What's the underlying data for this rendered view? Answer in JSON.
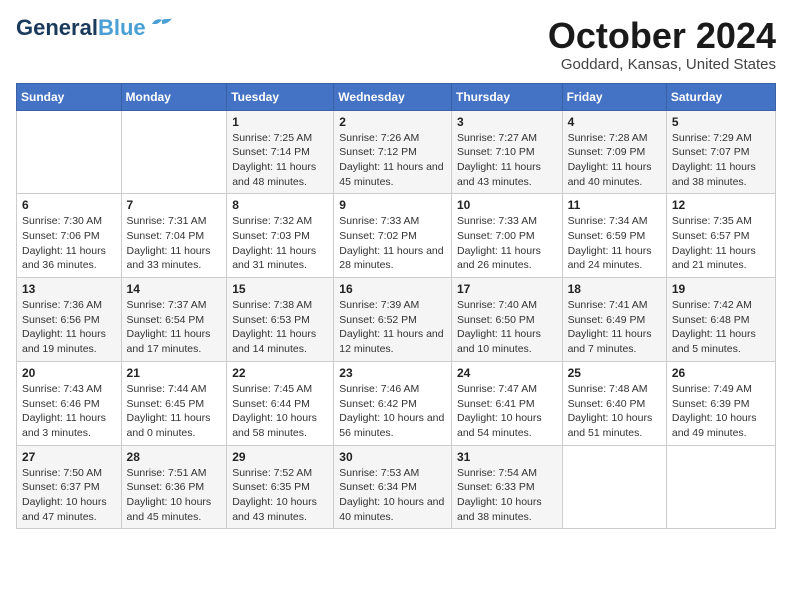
{
  "header": {
    "logo_line1": "General",
    "logo_line2": "Blue",
    "month_title": "October 2024",
    "location": "Goddard, Kansas, United States"
  },
  "weekdays": [
    "Sunday",
    "Monday",
    "Tuesday",
    "Wednesday",
    "Thursday",
    "Friday",
    "Saturday"
  ],
  "weeks": [
    [
      {
        "day": "",
        "info": ""
      },
      {
        "day": "",
        "info": ""
      },
      {
        "day": "1",
        "info": "Sunrise: 7:25 AM\nSunset: 7:14 PM\nDaylight: 11 hours and 48 minutes."
      },
      {
        "day": "2",
        "info": "Sunrise: 7:26 AM\nSunset: 7:12 PM\nDaylight: 11 hours and 45 minutes."
      },
      {
        "day": "3",
        "info": "Sunrise: 7:27 AM\nSunset: 7:10 PM\nDaylight: 11 hours and 43 minutes."
      },
      {
        "day": "4",
        "info": "Sunrise: 7:28 AM\nSunset: 7:09 PM\nDaylight: 11 hours and 40 minutes."
      },
      {
        "day": "5",
        "info": "Sunrise: 7:29 AM\nSunset: 7:07 PM\nDaylight: 11 hours and 38 minutes."
      }
    ],
    [
      {
        "day": "6",
        "info": "Sunrise: 7:30 AM\nSunset: 7:06 PM\nDaylight: 11 hours and 36 minutes."
      },
      {
        "day": "7",
        "info": "Sunrise: 7:31 AM\nSunset: 7:04 PM\nDaylight: 11 hours and 33 minutes."
      },
      {
        "day": "8",
        "info": "Sunrise: 7:32 AM\nSunset: 7:03 PM\nDaylight: 11 hours and 31 minutes."
      },
      {
        "day": "9",
        "info": "Sunrise: 7:33 AM\nSunset: 7:02 PM\nDaylight: 11 hours and 28 minutes."
      },
      {
        "day": "10",
        "info": "Sunrise: 7:33 AM\nSunset: 7:00 PM\nDaylight: 11 hours and 26 minutes."
      },
      {
        "day": "11",
        "info": "Sunrise: 7:34 AM\nSunset: 6:59 PM\nDaylight: 11 hours and 24 minutes."
      },
      {
        "day": "12",
        "info": "Sunrise: 7:35 AM\nSunset: 6:57 PM\nDaylight: 11 hours and 21 minutes."
      }
    ],
    [
      {
        "day": "13",
        "info": "Sunrise: 7:36 AM\nSunset: 6:56 PM\nDaylight: 11 hours and 19 minutes."
      },
      {
        "day": "14",
        "info": "Sunrise: 7:37 AM\nSunset: 6:54 PM\nDaylight: 11 hours and 17 minutes."
      },
      {
        "day": "15",
        "info": "Sunrise: 7:38 AM\nSunset: 6:53 PM\nDaylight: 11 hours and 14 minutes."
      },
      {
        "day": "16",
        "info": "Sunrise: 7:39 AM\nSunset: 6:52 PM\nDaylight: 11 hours and 12 minutes."
      },
      {
        "day": "17",
        "info": "Sunrise: 7:40 AM\nSunset: 6:50 PM\nDaylight: 11 hours and 10 minutes."
      },
      {
        "day": "18",
        "info": "Sunrise: 7:41 AM\nSunset: 6:49 PM\nDaylight: 11 hours and 7 minutes."
      },
      {
        "day": "19",
        "info": "Sunrise: 7:42 AM\nSunset: 6:48 PM\nDaylight: 11 hours and 5 minutes."
      }
    ],
    [
      {
        "day": "20",
        "info": "Sunrise: 7:43 AM\nSunset: 6:46 PM\nDaylight: 11 hours and 3 minutes."
      },
      {
        "day": "21",
        "info": "Sunrise: 7:44 AM\nSunset: 6:45 PM\nDaylight: 11 hours and 0 minutes."
      },
      {
        "day": "22",
        "info": "Sunrise: 7:45 AM\nSunset: 6:44 PM\nDaylight: 10 hours and 58 minutes."
      },
      {
        "day": "23",
        "info": "Sunrise: 7:46 AM\nSunset: 6:42 PM\nDaylight: 10 hours and 56 minutes."
      },
      {
        "day": "24",
        "info": "Sunrise: 7:47 AM\nSunset: 6:41 PM\nDaylight: 10 hours and 54 minutes."
      },
      {
        "day": "25",
        "info": "Sunrise: 7:48 AM\nSunset: 6:40 PM\nDaylight: 10 hours and 51 minutes."
      },
      {
        "day": "26",
        "info": "Sunrise: 7:49 AM\nSunset: 6:39 PM\nDaylight: 10 hours and 49 minutes."
      }
    ],
    [
      {
        "day": "27",
        "info": "Sunrise: 7:50 AM\nSunset: 6:37 PM\nDaylight: 10 hours and 47 minutes."
      },
      {
        "day": "28",
        "info": "Sunrise: 7:51 AM\nSunset: 6:36 PM\nDaylight: 10 hours and 45 minutes."
      },
      {
        "day": "29",
        "info": "Sunrise: 7:52 AM\nSunset: 6:35 PM\nDaylight: 10 hours and 43 minutes."
      },
      {
        "day": "30",
        "info": "Sunrise: 7:53 AM\nSunset: 6:34 PM\nDaylight: 10 hours and 40 minutes."
      },
      {
        "day": "31",
        "info": "Sunrise: 7:54 AM\nSunset: 6:33 PM\nDaylight: 10 hours and 38 minutes."
      },
      {
        "day": "",
        "info": ""
      },
      {
        "day": "",
        "info": ""
      }
    ]
  ]
}
